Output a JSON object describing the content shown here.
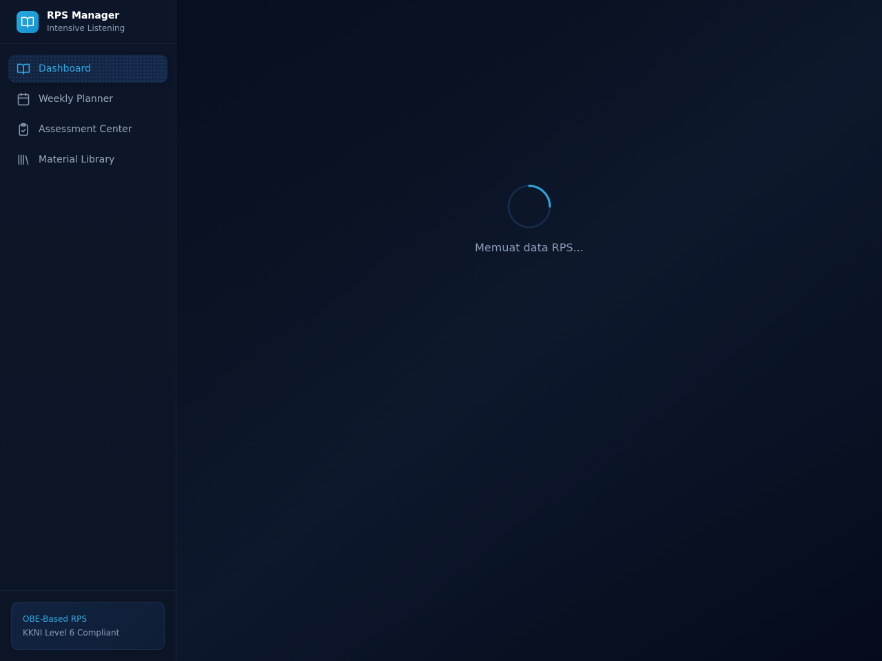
{
  "brand": {
    "title": "RPS Manager",
    "subtitle": "Intensive Listening",
    "icon": "book-open-icon"
  },
  "nav": {
    "items": [
      {
        "label": "Dashboard",
        "icon": "book-open-icon",
        "active": true
      },
      {
        "label": "Weekly Planner",
        "icon": "calendar-icon",
        "active": false
      },
      {
        "label": "Assessment Center",
        "icon": "clipboard-check-icon",
        "active": false
      },
      {
        "label": "Material Library",
        "icon": "library-icon",
        "active": false
      }
    ]
  },
  "footer": {
    "title": "OBE-Based RPS",
    "subtitle": "KKNI Level 6 Compliant"
  },
  "main": {
    "loading_text": "Memuat data RPS..."
  },
  "colors": {
    "accent": "#2fa8e0",
    "sidebar_bg": "#0d1628",
    "main_bg": "#0a1326",
    "muted_text": "#8a9ab4"
  }
}
